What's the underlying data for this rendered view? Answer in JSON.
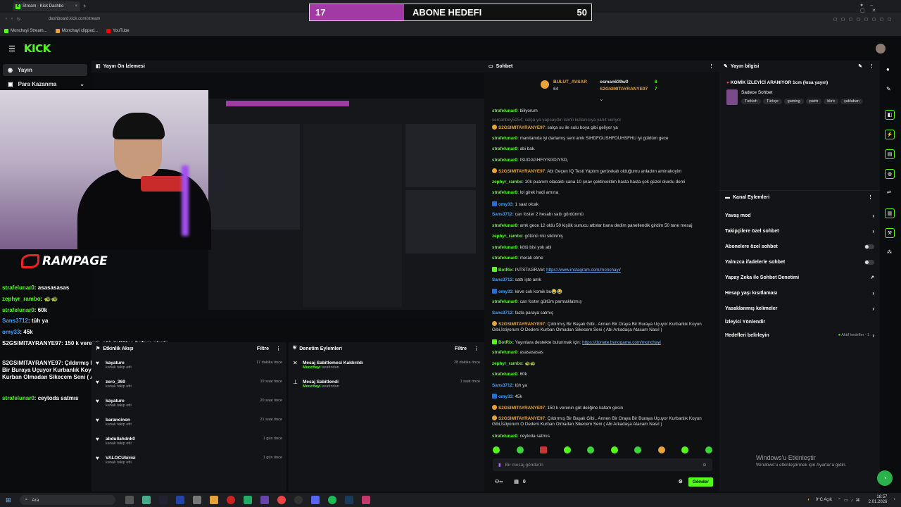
{
  "browser": {
    "tab_title": "Stream - Kick Dashbo",
    "url": "dashboard.kick.com/stream",
    "bookmarks": [
      "Monchayi Stream...",
      "Monchayi clipped...",
      "YouTube"
    ]
  },
  "goal_overlay": {
    "current": "17",
    "title": "ABONE HEDEFI",
    "target": "50"
  },
  "kick": {
    "logo": "KICK"
  },
  "nav": {
    "stream": "Yayın",
    "monetize": "Para Kazanma"
  },
  "preview": {
    "title": "Yayın Ön İzlemesi",
    "brand": "RAMPAGE"
  },
  "stream_chat": [
    {
      "user": "strafelunar0",
      "text": "asasasasas",
      "color": "green"
    },
    {
      "user": "zephyr_rambo",
      "text": "🐢🐢",
      "color": "green"
    },
    {
      "user": "strafelunar0",
      "text": "60k",
      "color": "green"
    },
    {
      "user": "Sans3712",
      "text": "tüh ya",
      "color": "blue"
    },
    {
      "user": "omy33",
      "text": "45k",
      "color": "blue"
    },
    {
      "user": "S2GSIMITAYRANYE97",
      "text": "150 k verenin göt deliğine kafam girsin",
      "color": "white"
    },
    {
      "user": "S2GSIMITAYRANYE97",
      "text": "Çıldırmış Bir Başak Gibi.. Annen Bir Oraya Bir Buraya Uçuyor Kurbanlık Koyun Gibi,İstiyorum O Dedeni Kurban Olmadan Sikecem Seni ( Abi Arkadaşa Atacam Nasıl )",
      "color": "white"
    },
    {
      "user": "strafelunar0",
      "text": "ceytoda satmıs",
      "color": "green"
    }
  ],
  "activity": {
    "title": "Etkinlik Akışı",
    "filter": "Filtre",
    "items": [
      {
        "name": "kayature",
        "sub": "kanalı takip etti",
        "time": "17 dakika önce"
      },
      {
        "name": "zero_369",
        "sub": "kanalı takip etti",
        "time": "19 saat önce"
      },
      {
        "name": "kayature",
        "sub": "kanalı takip etti",
        "time": "20 saat önce"
      },
      {
        "name": "barancinon",
        "sub": "kanalı takip etti",
        "time": "21 saat önce"
      },
      {
        "name": "abdullahdnk0",
        "sub": "kanalı takip etti",
        "time": "1 gün önce"
      },
      {
        "name": "VALOCUbirisi",
        "sub": "kanalı takip etti",
        "time": "1 gün önce"
      }
    ]
  },
  "moderation": {
    "title": "Denetim Eylemleri",
    "filter": "Filtre",
    "items": [
      {
        "name": "Mesaj Sabitlemesi Kaldırıldı",
        "by": "Monchayi",
        "sub": "tarafından",
        "time": "28 dakika önce"
      },
      {
        "name": "Mesaj Sabitlendi",
        "by": "Monchayi",
        "sub": "tarafından",
        "time": "1 saat önce"
      }
    ]
  },
  "chat": {
    "title": "Sohbet",
    "top_gifters": [
      {
        "name": "BULUT_AVSAR",
        "amount": "64"
      },
      {
        "name": "osman639w0",
        "amount": "8"
      },
      {
        "name": "S2GSIMITAYRANYE97",
        "amount": "7"
      }
    ],
    "messages": [
      {
        "user": "strafelunar0",
        "text": "biliyorum",
        "c": "g"
      },
      {
        "user": "sercanbey5254",
        "text": "salça ya yapsaydın isimli kullanıcıya yanıt veriyor",
        "c": "gr"
      },
      {
        "user": "S2GSIMITAYRANYE97",
        "text": "salça su ile sulu boya gibi geliyor ya",
        "c": "o"
      },
      {
        "user": "strafelunar0",
        "text": "manitamda iyi darlamış seni amk SIHDFOUSHFOUHSFHU iyi güldüm gece",
        "c": "g"
      },
      {
        "user": "strafelunar0",
        "text": "abi bak.",
        "c": "g"
      },
      {
        "user": "strafelunar0",
        "text": "ISUDAGHFIYSGDIYSD,",
        "c": "g"
      },
      {
        "user": "S2GSIMITAYRANYE97",
        "text": "Abi Geçen IQ Testi Yaptım gerizekalı olduğumu anladım aminakoyim",
        "c": "o"
      },
      {
        "user": "zephyr_rambo",
        "text": "10k puanım olacaktı sana 10 şnav çektircektim hasta hasta çok güzel olurdu demi",
        "c": "g"
      },
      {
        "user": "strafelunar0",
        "text": "lol girek hadi amına",
        "c": "g"
      },
      {
        "user": "omy33",
        "text": "1 saat olcak",
        "c": "b"
      },
      {
        "user": "Sans3712",
        "text": "can foster 2 hesabı sattı gördünmü",
        "c": "b"
      },
      {
        "user": "strafelunar0",
        "text": "amk gece 12 oldu 50 kişilik sunucu atbılar bana dedim panellendik girdim 50 tane mesaj",
        "c": "g"
      },
      {
        "user": "zephyr_rambo",
        "text": "götünü mü siktirmiş",
        "c": "g"
      },
      {
        "user": "strafelunar0",
        "text": "kötü bisi yok abi",
        "c": "g"
      },
      {
        "user": "strafelunar0",
        "text": "merak etme",
        "c": "g"
      },
      {
        "user": "BotRix",
        "text": "INTSTAGRAM: ",
        "link": "https://www.instagram.com/monchayi/",
        "c": "g"
      },
      {
        "user": "Sans3712",
        "text": "sattı işte amk",
        "c": "b"
      },
      {
        "user": "omy33",
        "text": "kirve cok komik bu😂😂",
        "c": "b"
      },
      {
        "user": "strafelunar0",
        "text": "can foster gültüm parmaklatmış",
        "c": "g"
      },
      {
        "user": "Sans3712",
        "text": "fazla paraya satmış",
        "c": "b"
      },
      {
        "user": "S2GSIMITAYRANYE97",
        "text": "Çıldırmış Bir Başak Gibi.. Annen Bir Oraya Bir Buraya Uçuyor Kurbanlık Koyun Gibi,İstiyorum O Dedeni Kurban Olmadan Sikecem Seni ( Abi Arkadaşa Atacam Nasıl )",
        "c": "o"
      },
      {
        "user": "BotRix",
        "text": "Yayınlara destekte bulunmak için: ",
        "link": "https://donate.bynogame.com/monchayi",
        "c": "g"
      },
      {
        "user": "strafelunar0",
        "text": "asasasasas",
        "c": "g"
      },
      {
        "user": "zephyr_rambo",
        "text": "🐢🐢",
        "c": "g"
      },
      {
        "user": "strafelunar0",
        "text": "60k",
        "c": "g"
      },
      {
        "user": "Sans3712",
        "text": "tüh ya",
        "c": "b"
      },
      {
        "user": "omy33",
        "text": "45k",
        "c": "b"
      },
      {
        "user": "S2GSIMITAYRANYE97",
        "text": "150 k verenin göt deliğine kafam girsin",
        "c": "o"
      },
      {
        "user": "S2GSIMITAYRANYE97",
        "text": "Çıldırmış Bir Başak Gibi.. Annen Bir Oraya Bir Buraya Uçuyor Kurbanlık Koyun Gibi,İstiyorum O Dedeni Kurban Olmadan Sikecem Seni ( Abi Arkadaşa Atacam Nasıl )",
        "c": "o"
      },
      {
        "user": "strafelunar0",
        "text": "ceytoda satmıs",
        "c": "g"
      }
    ],
    "input_placeholder": "Bir mesaj gönderin",
    "send_label": "Gönder",
    "points": "0"
  },
  "stream_info": {
    "title": "Yayın bilgisi",
    "stream_title": "KOMİK İZLEYİCİ ARANIYOR 1cm (kısa yayın)",
    "category": "Sadece Sohbet",
    "tags": [
      "Turkish",
      "Türkçe",
      "gaming",
      "patrtı",
      "bkrtı",
      "şaklaban"
    ]
  },
  "channel_actions": {
    "title": "Kanal Eylemleri",
    "items": [
      {
        "label": "Yavaş mod",
        "control": "arrow"
      },
      {
        "label": "Takipçilere özel sohbet",
        "control": "arrow"
      },
      {
        "label": "Abonelere özel sohbet",
        "control": "toggle"
      },
      {
        "label": "Yalnızca ifadelerle sohbet",
        "control": "toggle"
      },
      {
        "label": "Yapay Zeka ile Sohbet Denetimi",
        "control": "link"
      },
      {
        "label": "Hesap yaşı kısıtlaması",
        "control": "arrow"
      },
      {
        "label": "Yasaklanmış kelimeler",
        "control": "arrow"
      },
      {
        "label": "İzleyici Yönlendir",
        "control": "none"
      },
      {
        "label": "Hedefleri belirleyin",
        "control": "arrow",
        "badge": "Aktif hedefler - 1"
      }
    ]
  },
  "windows": {
    "activate_title": "Windows'u Etkinleştir",
    "activate_sub": "Windows'u etkinleştirmek için Ayarlar'a gidin."
  },
  "taskbar": {
    "search": "Ara",
    "weather": "0°C Açık",
    "time": "18:57",
    "date": "2.01.2026"
  },
  "colors": {
    "kick_green": "#53fc18",
    "goal_purple": "#a23aa6",
    "bg": "#0b0c0e"
  }
}
